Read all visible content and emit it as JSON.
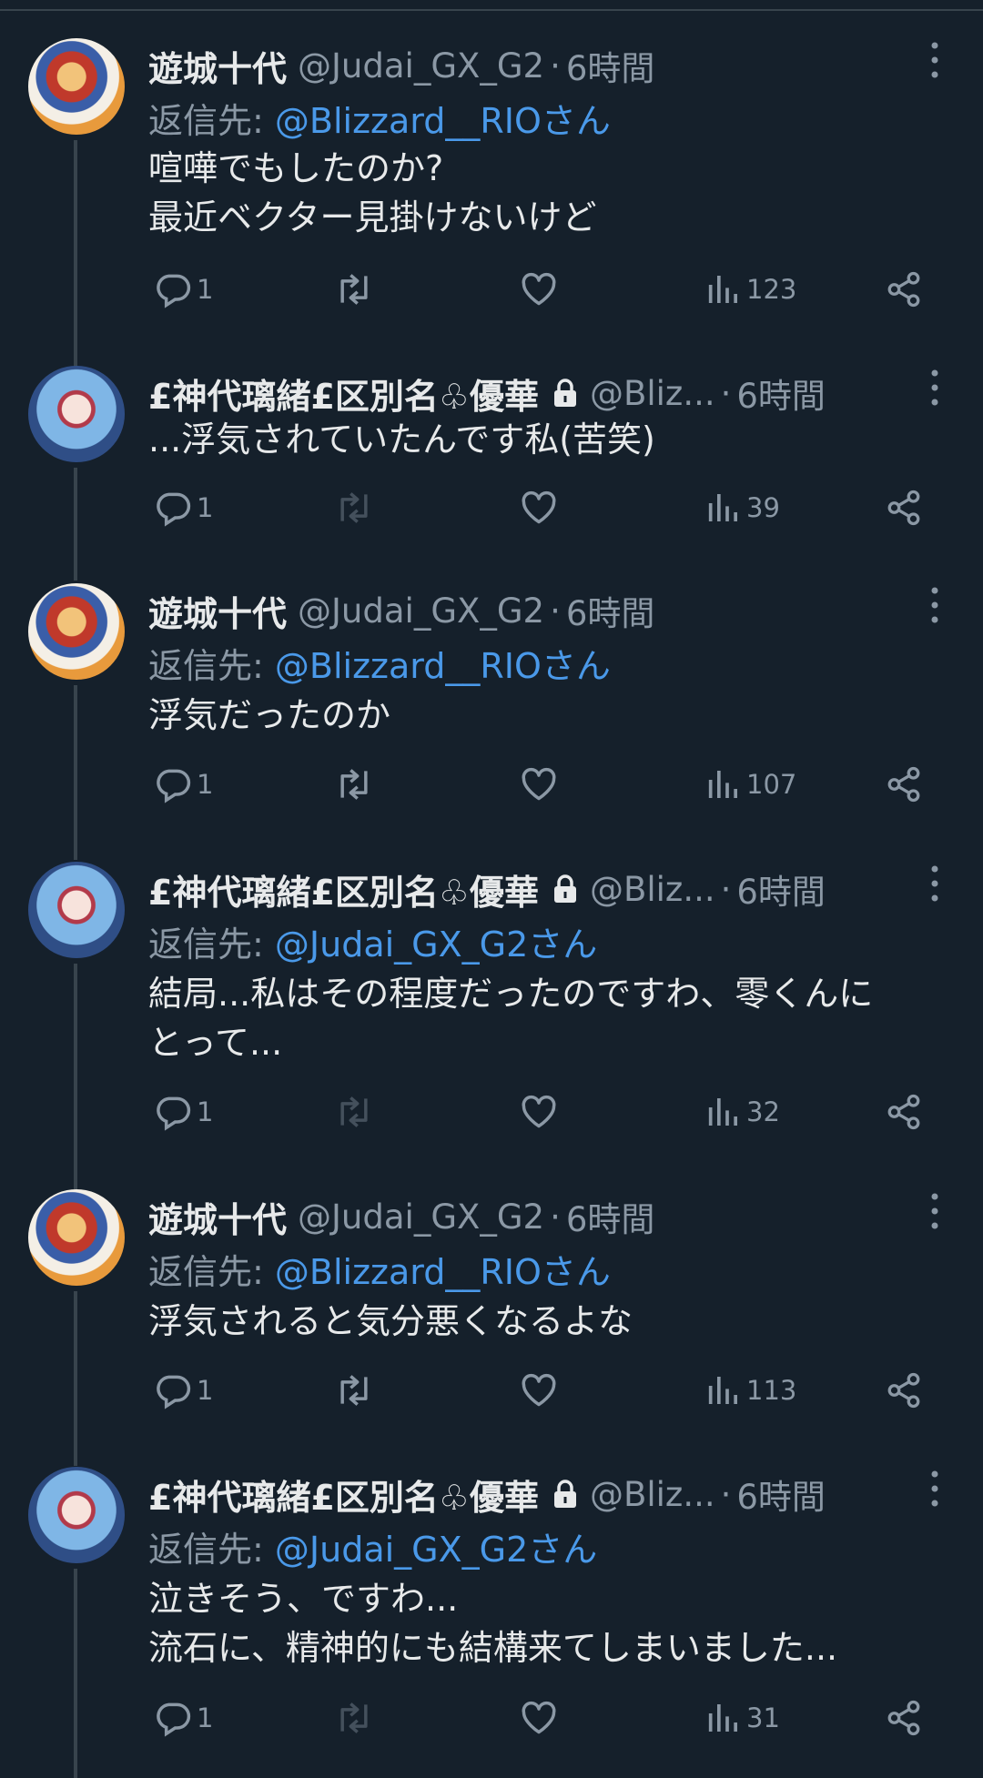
{
  "colors": {
    "background": "#15202b",
    "text": "#e7e9ea",
    "secondary": "#8b98a5",
    "link": "#4a99e9",
    "divider": "#38444d"
  },
  "tweets": [
    {
      "author": "遊城十代",
      "handle": "@Judai_GX_G2",
      "dot": "·",
      "time": "6時間",
      "reply_label": "返信先:",
      "reply_to": "@Blizzard__RIOさん",
      "text_lines": [
        "喧嘩でもしたのか?",
        "最近ベクター見掛けないけど"
      ],
      "replies": "1",
      "views": "123",
      "avatar": "judai-avatar",
      "locked": false,
      "retweet_enabled": true
    },
    {
      "author": "£神代璃緒£区別名♧優華",
      "handle": "@Bliz...",
      "dot": "·",
      "time": "6時間",
      "text_lines": [
        "...浮気されていたんです私(苦笑)"
      ],
      "replies": "1",
      "views": "39",
      "avatar": "rio-avatar",
      "locked": true,
      "retweet_enabled": false
    },
    {
      "author": "遊城十代",
      "handle": "@Judai_GX_G2",
      "dot": "·",
      "time": "6時間",
      "reply_label": "返信先:",
      "reply_to": "@Blizzard__RIOさん",
      "text_lines": [
        "浮気だったのか"
      ],
      "replies": "1",
      "views": "107",
      "avatar": "judai-avatar",
      "locked": false,
      "retweet_enabled": true
    },
    {
      "author": "£神代璃緒£区別名♧優華",
      "handle": "@Bliz...",
      "dot": "·",
      "time": "6時間",
      "reply_label": "返信先:",
      "reply_to": "@Judai_GX_G2さん",
      "text_lines": [
        "結局...私はその程度だったのですわ、零くんに",
        "とって..."
      ],
      "replies": "1",
      "views": "32",
      "avatar": "rio-avatar",
      "locked": true,
      "retweet_enabled": false
    },
    {
      "author": "遊城十代",
      "handle": "@Judai_GX_G2",
      "dot": "·",
      "time": "6時間",
      "reply_label": "返信先:",
      "reply_to": "@Blizzard__RIOさん",
      "text_lines": [
        "浮気されると気分悪くなるよな"
      ],
      "replies": "1",
      "views": "113",
      "avatar": "judai-avatar",
      "locked": false,
      "retweet_enabled": true
    },
    {
      "author": "£神代璃緒£区別名♧優華",
      "handle": "@Bliz...",
      "dot": "·",
      "time": "6時間",
      "reply_label": "返信先:",
      "reply_to": "@Judai_GX_G2さん",
      "text_lines": [
        "泣きそう、ですわ...",
        "流石に、精神的にも結構来てしまいました..."
      ],
      "replies": "1",
      "views": "31",
      "avatar": "rio-avatar",
      "locked": true,
      "retweet_enabled": false
    }
  ],
  "icons": {
    "reply": "reply-icon",
    "retweet": "retweet-icon",
    "like": "heart-icon",
    "views": "views-icon",
    "share": "share-icon",
    "more": "more-icon",
    "lock": "lock-icon"
  }
}
